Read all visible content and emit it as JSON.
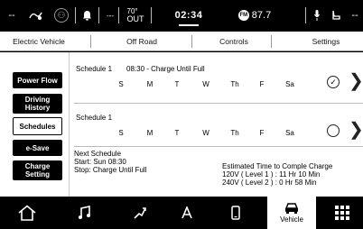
{
  "status_bar": {
    "dashes_left": "--",
    "outside_temp": "70°",
    "outside_label": "OUT",
    "time": "02:34",
    "radio_badge": "FM",
    "radio_station": "87.7",
    "dashes_right": "--"
  },
  "tabs": [
    {
      "label": "Electric Vehicle"
    },
    {
      "label": "Off Road"
    },
    {
      "label": "Controls"
    },
    {
      "label": "Settings"
    }
  ],
  "sidebar": {
    "items": [
      {
        "label": "Power Flow",
        "active": false
      },
      {
        "label": "Driving History",
        "active": false
      },
      {
        "label": "Schedules",
        "active": true
      },
      {
        "label": "e-Save",
        "active": false
      },
      {
        "label": "Charge Setting",
        "active": false
      }
    ]
  },
  "schedules": [
    {
      "title": "Schedule 1",
      "description": "08:30 - Charge Until Full",
      "days": [
        "S",
        "M",
        "T",
        "W",
        "Th",
        "F",
        "Sa"
      ],
      "checked": true,
      "check_mark": "✓",
      "arrow": "❯"
    },
    {
      "title": "Schedule 1",
      "description": "",
      "days": [
        "S",
        "M",
        "T",
        "W",
        "Th",
        "F",
        "Sa"
      ],
      "checked": false,
      "check_mark": "",
      "arrow": "❯"
    }
  ],
  "next_schedule": {
    "heading": "Next Schedule",
    "start": "Start: Sun 08:30",
    "stop": "Stop: Charge Until Full"
  },
  "estimate": {
    "heading": "Estimated Time to Comple Charge",
    "level1": "120V ( Level 1 ) : 11 Hr  10 Min",
    "level2": "240V ( Level 2 ) : 0 Hr  58 Min"
  },
  "bottom_nav": {
    "selected_label": "Vehicle"
  }
}
